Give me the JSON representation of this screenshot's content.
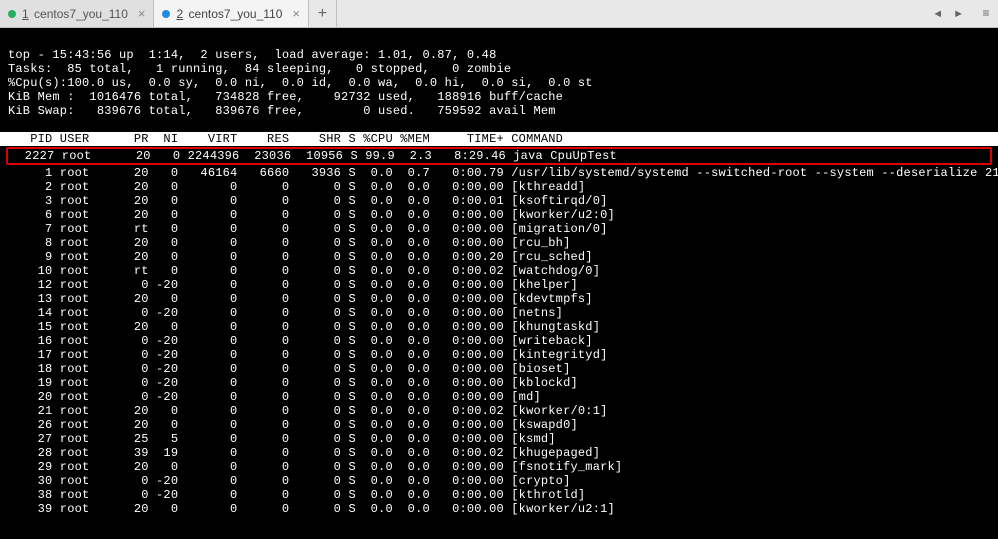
{
  "tabs": [
    {
      "num": "1",
      "label": "centos7_you_110",
      "status": "green",
      "active": false
    },
    {
      "num": "2",
      "label": "centos7_you_110",
      "status": "blue",
      "active": true
    }
  ],
  "summary": {
    "line1": "top - 15:43:56 up  1:14,  2 users,  load average: 1.01, 0.87, 0.48",
    "line2": "Tasks:  85 total,   1 running,  84 sleeping,   0 stopped,   0 zombie",
    "line3": "%Cpu(s):100.0 us,  0.0 sy,  0.0 ni,  0.0 id,  0.0 wa,  0.0 hi,  0.0 si,  0.0 st",
    "line4": "KiB Mem :  1016476 total,   734828 free,    92732 used,   188916 buff/cache",
    "line5": "KiB Swap:   839676 total,   839676 free,        0 used.   759592 avail Mem"
  },
  "header": "   PID USER      PR  NI    VIRT    RES    SHR S %CPU %MEM     TIME+ COMMAND",
  "highlight": "  2227 root      20   0 2244396  23036  10956 S 99.9  2.3   8:29.46 java CpuUpTest",
  "processes": [
    {
      "pid": "1",
      "user": "root",
      "pr": "20",
      "ni": "0",
      "virt": "46164",
      "res": "6660",
      "shr": "3936",
      "s": "S",
      "cpu": "0.0",
      "mem": "0.7",
      "time": "0:00.79",
      "cmd": "/usr/lib/systemd/systemd --switched-root --system --deserialize 21"
    },
    {
      "pid": "2",
      "user": "root",
      "pr": "20",
      "ni": "0",
      "virt": "0",
      "res": "0",
      "shr": "0",
      "s": "S",
      "cpu": "0.0",
      "mem": "0.0",
      "time": "0:00.00",
      "cmd": "[kthreadd]"
    },
    {
      "pid": "3",
      "user": "root",
      "pr": "20",
      "ni": "0",
      "virt": "0",
      "res": "0",
      "shr": "0",
      "s": "S",
      "cpu": "0.0",
      "mem": "0.0",
      "time": "0:00.01",
      "cmd": "[ksoftirqd/0]"
    },
    {
      "pid": "6",
      "user": "root",
      "pr": "20",
      "ni": "0",
      "virt": "0",
      "res": "0",
      "shr": "0",
      "s": "S",
      "cpu": "0.0",
      "mem": "0.0",
      "time": "0:00.00",
      "cmd": "[kworker/u2:0]"
    },
    {
      "pid": "7",
      "user": "root",
      "pr": "rt",
      "ni": "0",
      "virt": "0",
      "res": "0",
      "shr": "0",
      "s": "S",
      "cpu": "0.0",
      "mem": "0.0",
      "time": "0:00.00",
      "cmd": "[migration/0]"
    },
    {
      "pid": "8",
      "user": "root",
      "pr": "20",
      "ni": "0",
      "virt": "0",
      "res": "0",
      "shr": "0",
      "s": "S",
      "cpu": "0.0",
      "mem": "0.0",
      "time": "0:00.00",
      "cmd": "[rcu_bh]"
    },
    {
      "pid": "9",
      "user": "root",
      "pr": "20",
      "ni": "0",
      "virt": "0",
      "res": "0",
      "shr": "0",
      "s": "S",
      "cpu": "0.0",
      "mem": "0.0",
      "time": "0:00.20",
      "cmd": "[rcu_sched]"
    },
    {
      "pid": "10",
      "user": "root",
      "pr": "rt",
      "ni": "0",
      "virt": "0",
      "res": "0",
      "shr": "0",
      "s": "S",
      "cpu": "0.0",
      "mem": "0.0",
      "time": "0:00.02",
      "cmd": "[watchdog/0]"
    },
    {
      "pid": "12",
      "user": "root",
      "pr": "0",
      "ni": "-20",
      "virt": "0",
      "res": "0",
      "shr": "0",
      "s": "S",
      "cpu": "0.0",
      "mem": "0.0",
      "time": "0:00.00",
      "cmd": "[khelper]"
    },
    {
      "pid": "13",
      "user": "root",
      "pr": "20",
      "ni": "0",
      "virt": "0",
      "res": "0",
      "shr": "0",
      "s": "S",
      "cpu": "0.0",
      "mem": "0.0",
      "time": "0:00.00",
      "cmd": "[kdevtmpfs]"
    },
    {
      "pid": "14",
      "user": "root",
      "pr": "0",
      "ni": "-20",
      "virt": "0",
      "res": "0",
      "shr": "0",
      "s": "S",
      "cpu": "0.0",
      "mem": "0.0",
      "time": "0:00.00",
      "cmd": "[netns]"
    },
    {
      "pid": "15",
      "user": "root",
      "pr": "20",
      "ni": "0",
      "virt": "0",
      "res": "0",
      "shr": "0",
      "s": "S",
      "cpu": "0.0",
      "mem": "0.0",
      "time": "0:00.00",
      "cmd": "[khungtaskd]"
    },
    {
      "pid": "16",
      "user": "root",
      "pr": "0",
      "ni": "-20",
      "virt": "0",
      "res": "0",
      "shr": "0",
      "s": "S",
      "cpu": "0.0",
      "mem": "0.0",
      "time": "0:00.00",
      "cmd": "[writeback]"
    },
    {
      "pid": "17",
      "user": "root",
      "pr": "0",
      "ni": "-20",
      "virt": "0",
      "res": "0",
      "shr": "0",
      "s": "S",
      "cpu": "0.0",
      "mem": "0.0",
      "time": "0:00.00",
      "cmd": "[kintegrityd]"
    },
    {
      "pid": "18",
      "user": "root",
      "pr": "0",
      "ni": "-20",
      "virt": "0",
      "res": "0",
      "shr": "0",
      "s": "S",
      "cpu": "0.0",
      "mem": "0.0",
      "time": "0:00.00",
      "cmd": "[bioset]"
    },
    {
      "pid": "19",
      "user": "root",
      "pr": "0",
      "ni": "-20",
      "virt": "0",
      "res": "0",
      "shr": "0",
      "s": "S",
      "cpu": "0.0",
      "mem": "0.0",
      "time": "0:00.00",
      "cmd": "[kblockd]"
    },
    {
      "pid": "20",
      "user": "root",
      "pr": "0",
      "ni": "-20",
      "virt": "0",
      "res": "0",
      "shr": "0",
      "s": "S",
      "cpu": "0.0",
      "mem": "0.0",
      "time": "0:00.00",
      "cmd": "[md]"
    },
    {
      "pid": "21",
      "user": "root",
      "pr": "20",
      "ni": "0",
      "virt": "0",
      "res": "0",
      "shr": "0",
      "s": "S",
      "cpu": "0.0",
      "mem": "0.0",
      "time": "0:00.02",
      "cmd": "[kworker/0:1]"
    },
    {
      "pid": "26",
      "user": "root",
      "pr": "20",
      "ni": "0",
      "virt": "0",
      "res": "0",
      "shr": "0",
      "s": "S",
      "cpu": "0.0",
      "mem": "0.0",
      "time": "0:00.00",
      "cmd": "[kswapd0]"
    },
    {
      "pid": "27",
      "user": "root",
      "pr": "25",
      "ni": "5",
      "virt": "0",
      "res": "0",
      "shr": "0",
      "s": "S",
      "cpu": "0.0",
      "mem": "0.0",
      "time": "0:00.00",
      "cmd": "[ksmd]"
    },
    {
      "pid": "28",
      "user": "root",
      "pr": "39",
      "ni": "19",
      "virt": "0",
      "res": "0",
      "shr": "0",
      "s": "S",
      "cpu": "0.0",
      "mem": "0.0",
      "time": "0:00.02",
      "cmd": "[khugepaged]"
    },
    {
      "pid": "29",
      "user": "root",
      "pr": "20",
      "ni": "0",
      "virt": "0",
      "res": "0",
      "shr": "0",
      "s": "S",
      "cpu": "0.0",
      "mem": "0.0",
      "time": "0:00.00",
      "cmd": "[fsnotify_mark]"
    },
    {
      "pid": "30",
      "user": "root",
      "pr": "0",
      "ni": "-20",
      "virt": "0",
      "res": "0",
      "shr": "0",
      "s": "S",
      "cpu": "0.0",
      "mem": "0.0",
      "time": "0:00.00",
      "cmd": "[crypto]"
    },
    {
      "pid": "38",
      "user": "root",
      "pr": "0",
      "ni": "-20",
      "virt": "0",
      "res": "0",
      "shr": "0",
      "s": "S",
      "cpu": "0.0",
      "mem": "0.0",
      "time": "0:00.00",
      "cmd": "[kthrotld]"
    },
    {
      "pid": "39",
      "user": "root",
      "pr": "20",
      "ni": "0",
      "virt": "0",
      "res": "0",
      "shr": "0",
      "s": "S",
      "cpu": "0.0",
      "mem": "0.0",
      "time": "0:00.00",
      "cmd": "[kworker/u2:1]"
    }
  ]
}
